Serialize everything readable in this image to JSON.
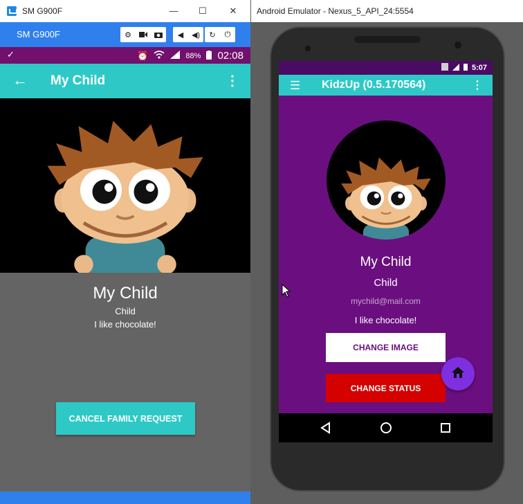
{
  "left_window": {
    "title": "SM G900F",
    "mirror_toolbar": {
      "device_name": "SM G900F"
    },
    "statusbar": {
      "battery": "88%",
      "time": "02:08"
    },
    "appbar": {
      "title": "My Child"
    },
    "profile": {
      "name": "My Child",
      "role": "Child",
      "status": "I like chocolate!"
    },
    "cancel_button": "CANCEL FAMILY REQUEST"
  },
  "right_window": {
    "title": "Android Emulator - Nexus_5_API_24:5554",
    "statusbar": {
      "time": "5:07"
    },
    "appbar": {
      "title": "KidzUp (0.5.170564)"
    },
    "profile": {
      "name": "My Child",
      "role": "Child",
      "email": "mychild@mail.com",
      "status": "I like chocolate!"
    },
    "change_image_button": "CHANGE IMAGE",
    "change_status_button": "CHANGE STATUS"
  },
  "colors": {
    "teal": "#2ec9c6",
    "purple": "#6b0f80",
    "status_purple": "#71106d",
    "red": "#d50000",
    "fab": "#7e2fe0",
    "mirror_blue": "#2f80ed"
  }
}
